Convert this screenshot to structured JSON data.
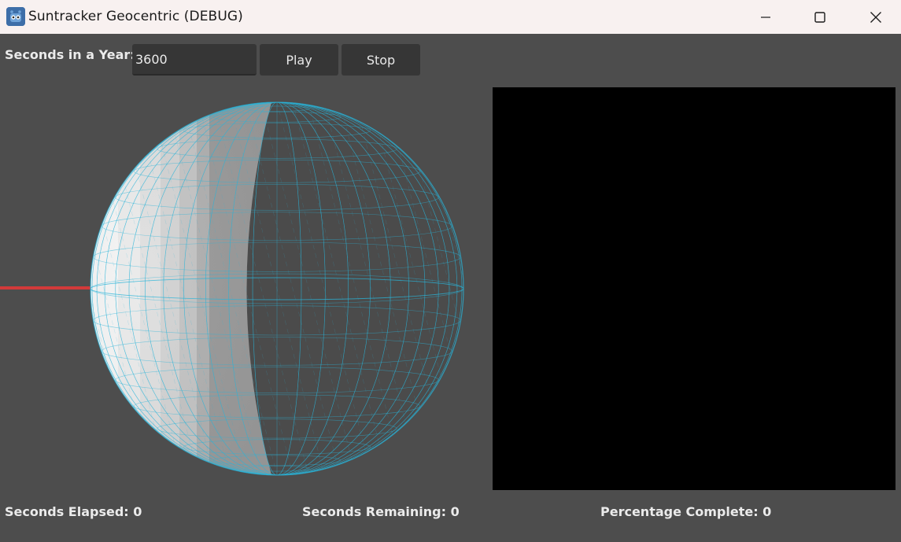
{
  "window": {
    "title": "Suntracker Geocentric (DEBUG)",
    "icon": "godot-engine-icon"
  },
  "toolbar": {
    "seconds_label": "Seconds in a Year:",
    "seconds_value": "3600",
    "play_label": "Play",
    "stop_label": "Stop"
  },
  "viewport": {
    "sphere_wire_color": "#2ab4d8",
    "sun_ray_color": "#d23a3a",
    "lit_color": "#e6e6e6",
    "shadow_color": "#4b4b4b"
  },
  "status": {
    "elapsed": "Seconds Elapsed: 0",
    "remaining": "Seconds Remaining: 0",
    "percent": "Percentage Complete: 0"
  }
}
